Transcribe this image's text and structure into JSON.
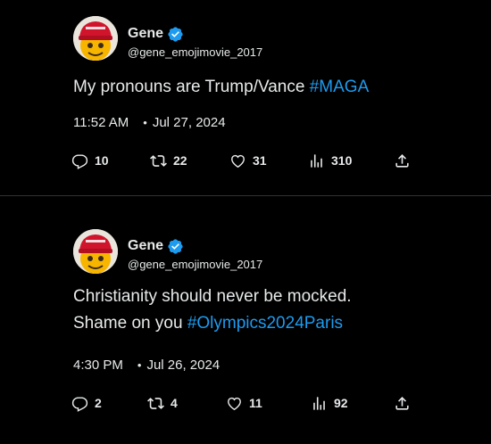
{
  "tweets": [
    {
      "author_name": "Gene",
      "handle": "@gene_emojimovie_2017",
      "text_lines": [
        "My pronouns are Trump/Vance "
      ],
      "hashtag": "#MAGA",
      "time": "11:52 AM",
      "separator": "•",
      "date": "Jul 27, 2024",
      "replies": "10",
      "retweets": "22",
      "likes": "31",
      "views": "310"
    },
    {
      "author_name": "Gene",
      "handle": "@gene_emojimovie_2017",
      "text_lines": [
        "Christianity should never be mocked.",
        "Shame on you "
      ],
      "hashtag": "#Olympics2024Paris",
      "time": "4:30 PM",
      "separator": "•",
      "date": "Jul 26, 2024",
      "replies": "2",
      "retweets": "4",
      "likes": "11",
      "views": "92"
    }
  ],
  "colors": {
    "background": "#000000",
    "text": "#e7e9ea",
    "hashtag": "#1d9bf0",
    "verified": "#1d9bf0",
    "divider": "#2f3336"
  },
  "icons": [
    "reply-icon",
    "retweet-icon",
    "like-icon",
    "views-icon",
    "share-icon",
    "verified-badge-icon"
  ]
}
